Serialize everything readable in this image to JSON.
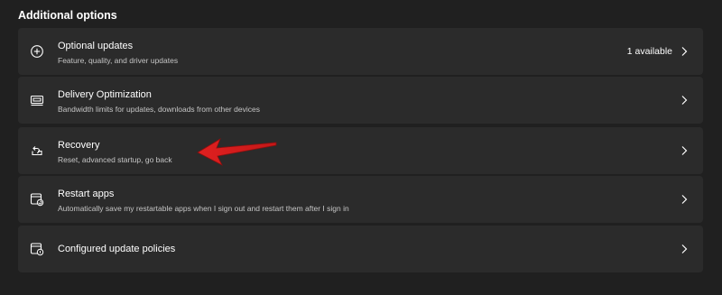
{
  "section": {
    "title": "Additional options"
  },
  "items": [
    {
      "title": "Optional updates",
      "subtitle": "Feature, quality, and driver updates",
      "status": "1 available",
      "icon": "plus-circle-icon"
    },
    {
      "title": "Delivery Optimization",
      "subtitle": "Bandwidth limits for updates, downloads from other devices",
      "icon": "delivery-optimization-icon"
    },
    {
      "title": "Recovery",
      "subtitle": "Reset, advanced startup, go back",
      "icon": "recovery-icon"
    },
    {
      "title": "Restart apps",
      "subtitle": "Automatically save my restartable apps when I sign out and restart them after I sign in",
      "icon": "restart-apps-icon"
    },
    {
      "title": "Configured update policies",
      "icon": "update-policies-icon"
    }
  ],
  "colors": {
    "background": "#202020",
    "card": "#2b2b2b",
    "annotation_arrow": "#e02020"
  }
}
